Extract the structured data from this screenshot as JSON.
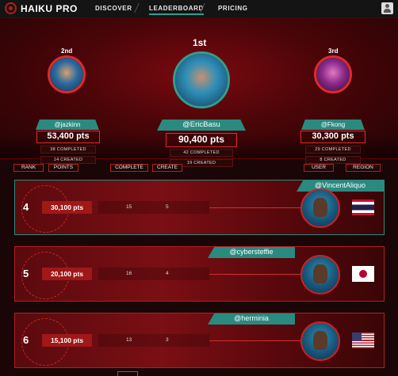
{
  "brand": "HAIKU PRO",
  "nav": {
    "discover": "DISCOVER",
    "leaderboard": "LEADERBOARD",
    "pricing": "PRICING"
  },
  "podium": [
    {
      "rank_word": "2nd",
      "handle": "@jazkinn",
      "points": "53,400 pts",
      "completed": "38 COMPLETED",
      "created": "14 CREATED",
      "ring_color": "#e02a2a"
    },
    {
      "rank_word": "1st",
      "handle": "@EricBasu",
      "points": "90,400 pts",
      "completed": "42 COMPLETED",
      "created": "19 CREATED",
      "ring_color": "#2fa08f"
    },
    {
      "rank_word": "3rd",
      "handle": "@Fkong",
      "points": "30,300 pts",
      "completed": "29 COMPLETED",
      "created": "8 CREATED",
      "ring_color": "#e02a2a"
    }
  ],
  "headers": {
    "rank": "RANK",
    "points": "POINTS",
    "complete": "COMPLETE",
    "create": "CREATE",
    "user": "USER",
    "region": "REGION"
  },
  "rows": [
    {
      "rank": "4",
      "handle": "@VincentAliquo",
      "points": "30,100 pts",
      "complete": "15",
      "create": "5",
      "flag_icon": "thailand-flag-icon"
    },
    {
      "rank": "5",
      "handle": "@cybersteffie",
      "points": "20,100 pts",
      "complete": "16",
      "create": "4",
      "flag_icon": "japan-flag-icon"
    },
    {
      "rank": "6",
      "handle": "@herminia",
      "points": "15,100 pts",
      "complete": "13",
      "create": "3",
      "flag_icon": "usa-flag-icon"
    }
  ],
  "colors": {
    "accent_red": "#e02a2a",
    "accent_teal": "#2fa08f",
    "bg_dark": "#1a0606"
  }
}
